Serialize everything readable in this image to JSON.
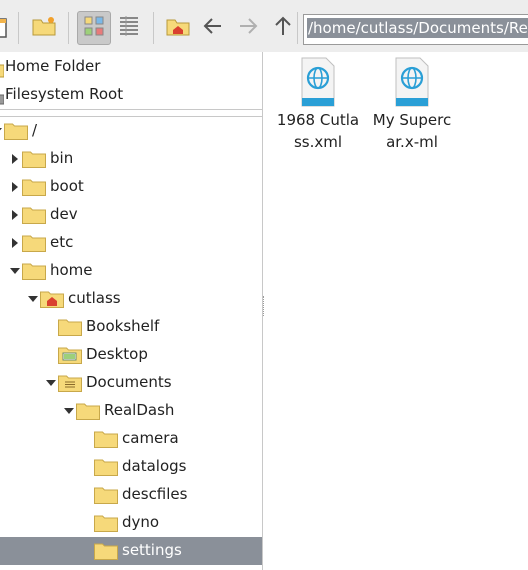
{
  "toolbar": {
    "buttons": [
      {
        "name": "partial-left-icon"
      },
      {
        "name": "new-folder-icon"
      },
      {
        "name": "icon-view-icon"
      },
      {
        "name": "list-view-icon"
      },
      {
        "name": "home-folder-icon"
      },
      {
        "name": "back-arrow-icon"
      },
      {
        "name": "forward-arrow-icon"
      },
      {
        "name": "up-arrow-icon"
      }
    ],
    "path": "/home/cutlass/Documents/RealDash/settings"
  },
  "places": {
    "home": "Home Folder",
    "root": "Filesystem Root"
  },
  "tree": [
    {
      "label": "/",
      "expander": "down",
      "indent": 0,
      "icon": "folder"
    },
    {
      "label": "bin",
      "expander": "right",
      "indent": 1,
      "icon": "folder"
    },
    {
      "label": "boot",
      "expander": "right",
      "indent": 1,
      "icon": "folder"
    },
    {
      "label": "dev",
      "expander": "right",
      "indent": 1,
      "icon": "folder"
    },
    {
      "label": "etc",
      "expander": "right",
      "indent": 1,
      "icon": "folder"
    },
    {
      "label": "home",
      "expander": "down",
      "indent": 1,
      "icon": "folder"
    },
    {
      "label": "cutlass",
      "expander": "down",
      "indent": 2,
      "icon": "home-folder"
    },
    {
      "label": "Bookshelf",
      "expander": "none",
      "indent": 3,
      "icon": "folder"
    },
    {
      "label": "Desktop",
      "expander": "none",
      "indent": 3,
      "icon": "desktop-folder"
    },
    {
      "label": "Documents",
      "expander": "down",
      "indent": 3,
      "icon": "documents-folder"
    },
    {
      "label": "RealDash",
      "expander": "down",
      "indent": 4,
      "icon": "folder"
    },
    {
      "label": "camera",
      "expander": "none",
      "indent": 5,
      "icon": "folder"
    },
    {
      "label": "datalogs",
      "expander": "none",
      "indent": 5,
      "icon": "folder"
    },
    {
      "label": "descfiles",
      "expander": "none",
      "indent": 5,
      "icon": "folder"
    },
    {
      "label": "dyno",
      "expander": "none",
      "indent": 5,
      "icon": "folder"
    },
    {
      "label": "settings",
      "expander": "none",
      "indent": 5,
      "icon": "folder",
      "selected": true
    }
  ],
  "files": [
    {
      "name": "1968 Cutlass.xml"
    },
    {
      "name": "My Supercar.x-ml"
    }
  ],
  "colors": {
    "selection": "#8a9099",
    "folder": "#f6d97a",
    "file_icon_blue": "#2a9fd6"
  }
}
